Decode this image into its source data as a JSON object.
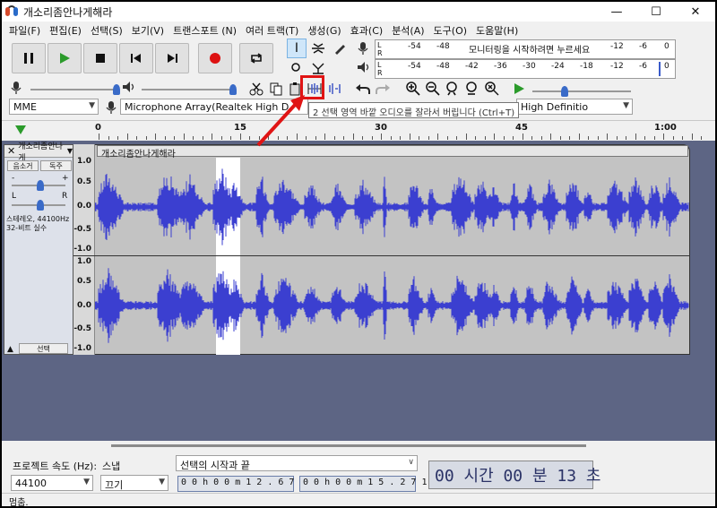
{
  "window": {
    "title": "개소리좀안나게해라",
    "controls": [
      "minimize",
      "maximize",
      "close"
    ]
  },
  "menu": [
    "파일(F)",
    "편집(E)",
    "선택(S)",
    "보기(V)",
    "트랜스포트 (N)",
    "여러 트랙(T)",
    "생성(G)",
    "효과(C)",
    "분석(A)",
    "도구(O)",
    "도움말(H)"
  ],
  "transport": [
    "pause-icon",
    "play-icon",
    "stop-icon",
    "skip-start-icon",
    "skip-end-icon",
    "record-icon",
    "loop-icon"
  ],
  "meters": {
    "record_scale": [
      "-54",
      "-48",
      "모니터링을 시작하려면 누르세요",
      "-12",
      "-6",
      "0"
    ],
    "play_scale": [
      "-54",
      "-48",
      "-42",
      "-36",
      "-30",
      "-24",
      "-18",
      "-12",
      "-6",
      "0"
    ],
    "lr": [
      "L",
      "R"
    ]
  },
  "device": {
    "host": "MME",
    "input": "Microphone Array(Realtek High D",
    "output": "High Definitio"
  },
  "tooltip": "2 선택 영역 바깥 오디오를 잘라서 버립니다 (Ctrl+T)",
  "ruler": {
    "labels": [
      "0",
      "15",
      "30",
      "45",
      "1:00"
    ]
  },
  "track": {
    "name": "개소리좀안나게해라",
    "panel_name": "개소리좀안나게",
    "mute": "음소거",
    "solo": "독주",
    "gain_left": "-",
    "gain_right": "+",
    "pan_left": "L",
    "pan_right": "R",
    "info_line1": "스테레오, 44100Hz",
    "info_line2": "32-비트 실수",
    "select": "선택",
    "scale": [
      "1.0",
      "0.5",
      "0.0",
      "-0.5",
      "-1.0"
    ]
  },
  "bottom": {
    "rate_label": "프로젝트 속도 (Hz):",
    "rate_value": "44100",
    "snap_label": "스냅",
    "snap_value": "끄기",
    "selection_label": "선택의 시작과 끝",
    "start": "0 0 h 0 0 m 1 2 . 6 7 5 s",
    "end": "0 0 h 0 0 m 1 5 . 2 7 1 s",
    "time": "00 시간 00 분 13 초",
    "status": "멈춤."
  },
  "colors": {
    "wave": "#3b3fd0",
    "track_bg": "#5d6584",
    "selection": "#ffffff",
    "highlight": "#e01414"
  }
}
